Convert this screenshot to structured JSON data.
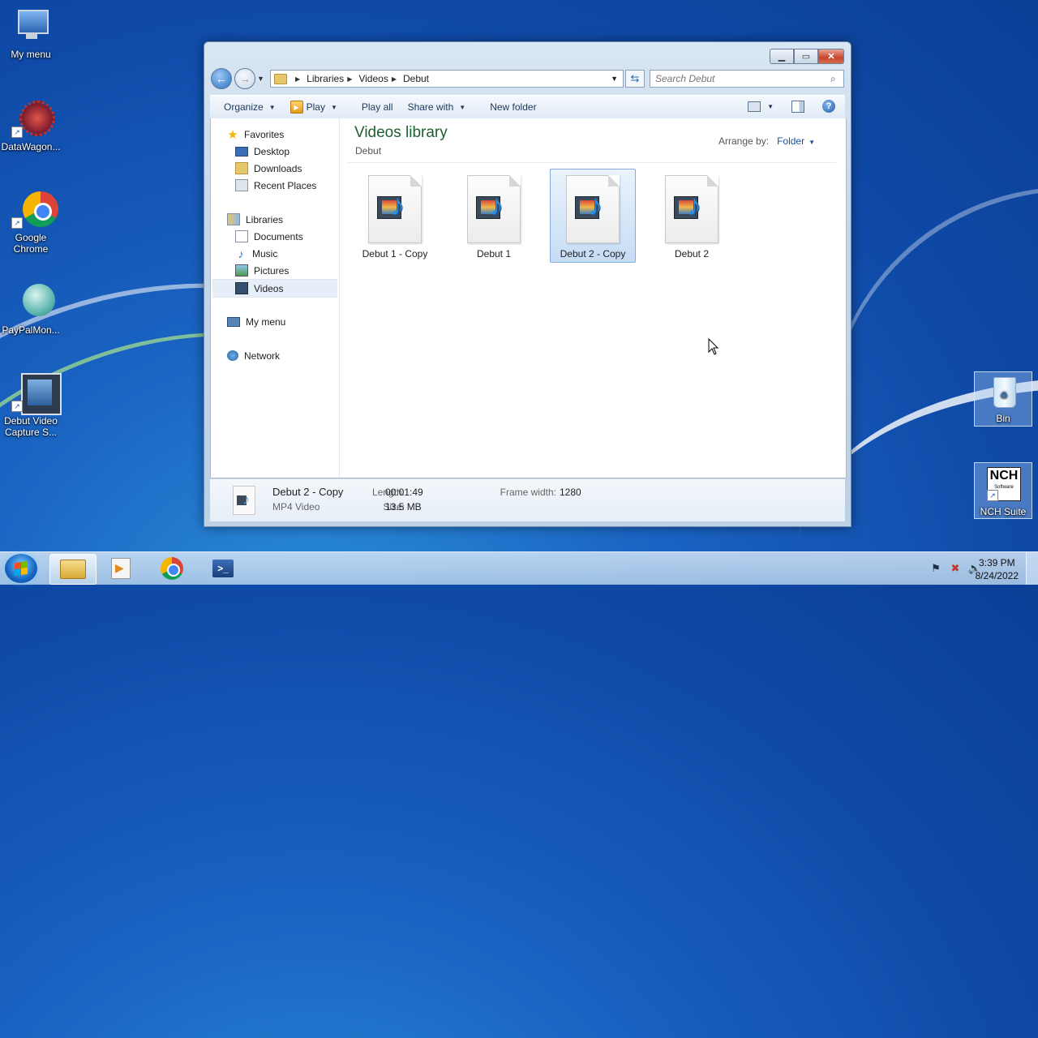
{
  "desktop": {
    "icons": [
      {
        "label": "My menu",
        "icon": "computer-icon"
      },
      {
        "label": "DataWagon...",
        "icon": "datawagon-icon"
      },
      {
        "label": "Google Chrome",
        "icon": "chrome-icon"
      },
      {
        "label": "PayPalMon...",
        "icon": "paypal-monitor-icon"
      },
      {
        "label": "Debut Video Capture S...",
        "icon": "debut-video-icon"
      },
      {
        "label": "Bin",
        "icon": "recycle-bin-icon"
      },
      {
        "label": "NCH Suite",
        "icon": "nch-icon"
      }
    ]
  },
  "window": {
    "address": {
      "crumbs": [
        "Libraries",
        "Videos",
        "Debut"
      ]
    },
    "search": {
      "placeholder": "Search Debut"
    },
    "toolbar": {
      "organize": "Organize",
      "play": "Play",
      "play_all": "Play all",
      "share_with": "Share with",
      "new_folder": "New folder"
    },
    "nav": {
      "favorites": {
        "label": "Favorites",
        "items": [
          "Desktop",
          "Downloads",
          "Recent Places"
        ]
      },
      "libraries": {
        "label": "Libraries",
        "items": [
          "Documents",
          "Music",
          "Pictures",
          "Videos"
        ]
      },
      "computer": "My menu",
      "network": "Network"
    },
    "main": {
      "title": "Videos library",
      "subtitle": "Debut",
      "arrange_label": "Arrange by:",
      "arrange_value": "Folder",
      "files": [
        {
          "name": "Debut 1 - Copy",
          "selected": false
        },
        {
          "name": "Debut 1",
          "selected": false
        },
        {
          "name": "Debut 2 - Copy",
          "selected": true
        },
        {
          "name": "Debut 2",
          "selected": false
        }
      ]
    },
    "details": {
      "name": "Debut 2 - Copy",
      "type": "MP4 Video",
      "length_label": "Length:",
      "length": "00:01:49",
      "size_label": "Size:",
      "size": "13.5 MB",
      "frame_width_label": "Frame width:",
      "frame_width": "1280"
    }
  },
  "taskbar": {
    "apps": [
      "windows-explorer",
      "debut",
      "google-chrome",
      "powershell"
    ],
    "clock": {
      "time": "3:39 PM",
      "date": "8/24/2022"
    }
  }
}
